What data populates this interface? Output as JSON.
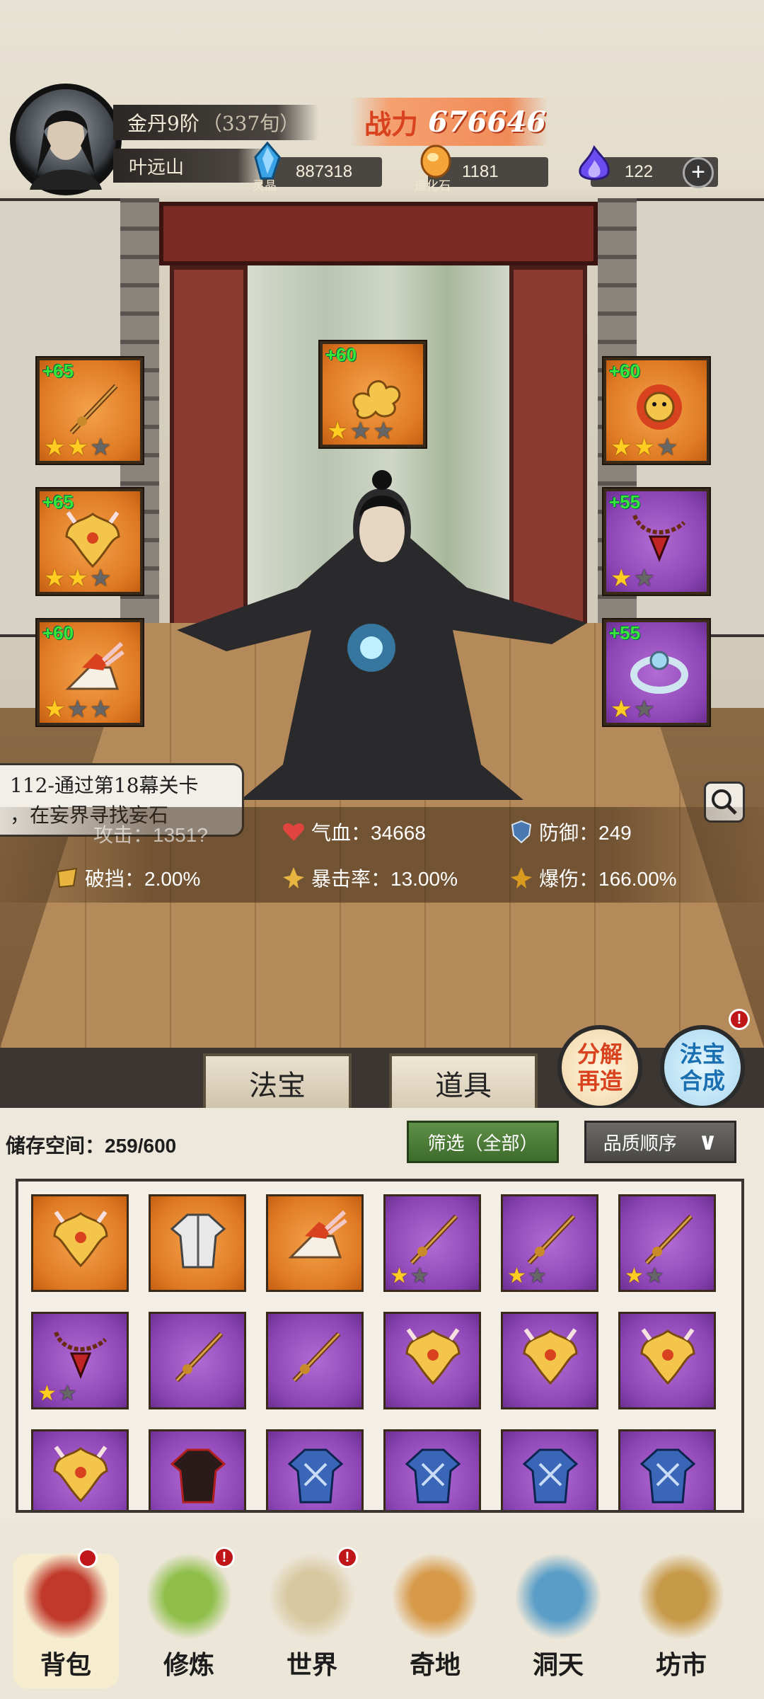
{
  "player": {
    "realm": "金丹9阶",
    "age": "（337旬）",
    "name": "叶远山"
  },
  "combat_power": {
    "label": "战力",
    "value": "676646"
  },
  "resources": [
    {
      "icon": "spirit-crystal-icon",
      "label": "灵晶",
      "value": "887318"
    },
    {
      "icon": "creation-stone-icon",
      "label": "造化石",
      "value": "1181"
    },
    {
      "icon": "soul-fire-icon",
      "label": "",
      "value": "122"
    }
  ],
  "equipment": {
    "left": [
      {
        "icon": "sword-icon",
        "bonus": "+65",
        "rarity": "orange",
        "stars": 2,
        "max_stars": 3
      },
      {
        "icon": "golden-armor-icon",
        "bonus": "+65",
        "rarity": "orange",
        "stars": 2,
        "max_stars": 3
      },
      {
        "icon": "winged-boot-icon",
        "bonus": "+60",
        "rarity": "orange",
        "stars": 1,
        "max_stars": 3
      }
    ],
    "center": {
      "icon": "golden-cloud-charm-icon",
      "bonus": "+60",
      "rarity": "orange",
      "stars": 1,
      "max_stars": 3
    },
    "right": [
      {
        "icon": "lion-beast-icon",
        "bonus": "+60",
        "rarity": "orange",
        "stars": 2,
        "max_stars": 3
      },
      {
        "icon": "beads-pendant-icon",
        "bonus": "+55",
        "rarity": "purple",
        "stars": 1,
        "max_stars": 2
      },
      {
        "icon": "jade-bracelet-icon",
        "bonus": "+55",
        "rarity": "purple",
        "stars": 1,
        "max_stars": 2
      }
    ]
  },
  "quest": {
    "line1": "112-通过第18幕关卡",
    "line2": "，在妄界寻找妄石"
  },
  "stats": {
    "attack": "攻击：1351?",
    "hp": "气血：34668",
    "defense": "防御：249",
    "break": "破挡：2.00%",
    "crit_rate": "暴击率：13.00%",
    "crit_dmg": "爆伤：166.00%"
  },
  "tabs": {
    "treasure": "法宝",
    "items": "道具"
  },
  "actions": {
    "decompose": [
      "分解",
      "再造"
    ],
    "synthesize": [
      "法宝",
      "合成"
    ],
    "badge": "!"
  },
  "storage": {
    "label": "储存空间：",
    "value": "259/600"
  },
  "filter": {
    "label": "筛选（全部）"
  },
  "sort": {
    "label": "品质顺序",
    "arrow": "∨"
  },
  "inventory": [
    {
      "icon": "golden-armor-icon",
      "rarity": "orange",
      "stars": 0
    },
    {
      "icon": "white-robe-icon",
      "rarity": "orange",
      "stars": 0
    },
    {
      "icon": "winged-boot-icon",
      "rarity": "orange",
      "stars": 0
    },
    {
      "icon": "sword-icon",
      "rarity": "purple",
      "stars": 1
    },
    {
      "icon": "sword-icon",
      "rarity": "purple",
      "stars": 1
    },
    {
      "icon": "sword-icon",
      "rarity": "purple",
      "stars": 1
    },
    {
      "icon": "beads-pendant-icon",
      "rarity": "purple",
      "stars": 1
    },
    {
      "icon": "sword-icon",
      "rarity": "purple",
      "stars": 0
    },
    {
      "icon": "sword-icon",
      "rarity": "purple",
      "stars": 0
    },
    {
      "icon": "golden-armor-icon",
      "rarity": "purple",
      "stars": 0
    },
    {
      "icon": "golden-armor-icon",
      "rarity": "purple",
      "stars": 0
    },
    {
      "icon": "golden-armor-icon",
      "rarity": "purple",
      "stars": 0
    },
    {
      "icon": "golden-armor-icon",
      "rarity": "purple",
      "stars": 0
    },
    {
      "icon": "dark-robe-icon",
      "rarity": "purple",
      "stars": 0
    },
    {
      "icon": "blue-robe-icon",
      "rarity": "purple",
      "stars": 0
    },
    {
      "icon": "blue-robe-icon",
      "rarity": "purple",
      "stars": 0
    },
    {
      "icon": "blue-robe-icon",
      "rarity": "purple",
      "stars": 0
    },
    {
      "icon": "blue-robe-icon",
      "rarity": "purple",
      "stars": 0
    }
  ],
  "nav": [
    {
      "label": "背包",
      "icon": "backpack-icon",
      "badge": false
    },
    {
      "label": "修炼",
      "icon": "cultivation-icon",
      "badge": true
    },
    {
      "label": "世界",
      "icon": "world-scroll-icon",
      "badge": true
    },
    {
      "label": "奇地",
      "icon": "wonderland-icon",
      "badge": false
    },
    {
      "label": "洞天",
      "icon": "cave-portal-icon",
      "badge": false
    },
    {
      "label": "坊市",
      "icon": "market-icon",
      "badge": false
    }
  ],
  "colors": {
    "orange": "#e07a24",
    "purple": "#8d45b6",
    "plus_green": "#39e63a",
    "star_gold": "#ffcc22",
    "power_red": "#d9421e"
  }
}
